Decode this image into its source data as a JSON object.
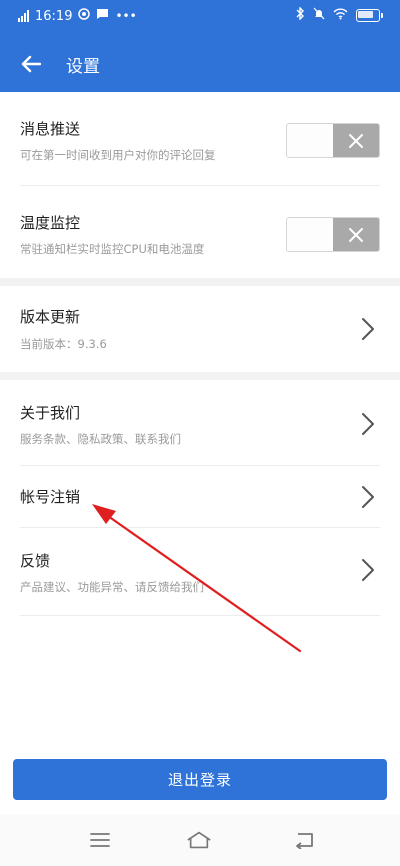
{
  "status_bar": {
    "time": "16:19",
    "network": "4G"
  },
  "header": {
    "title": "设置"
  },
  "settings": {
    "push": {
      "title": "消息推送",
      "subtitle": "可在第一时间收到用户对你的评论回复"
    },
    "temp_monitor": {
      "title": "温度监控",
      "subtitle": "常驻通知栏实时监控CPU和电池温度"
    },
    "version": {
      "title": "版本更新",
      "subtitle": "当前版本：9.3.6"
    },
    "about": {
      "title": "关于我们",
      "subtitle": "服务条款、隐私政策、联系我们"
    },
    "account_cancel": {
      "title": "帐号注销"
    },
    "feedback": {
      "title": "反馈",
      "subtitle": "产品建议、功能异常、请反馈给我们"
    }
  },
  "logout": {
    "label": "退出登录"
  },
  "icons": {
    "back": "arrow-left-icon",
    "chevron": "chevron-right-icon",
    "toggle_off": "close-x-icon",
    "menu": "menu-icon",
    "home": "home-icon",
    "back_nav": "back-nav-icon"
  },
  "colors": {
    "primary": "#2f73d9",
    "toggle_off": "#a9a9a9",
    "annotation_arrow": "#e02020"
  }
}
